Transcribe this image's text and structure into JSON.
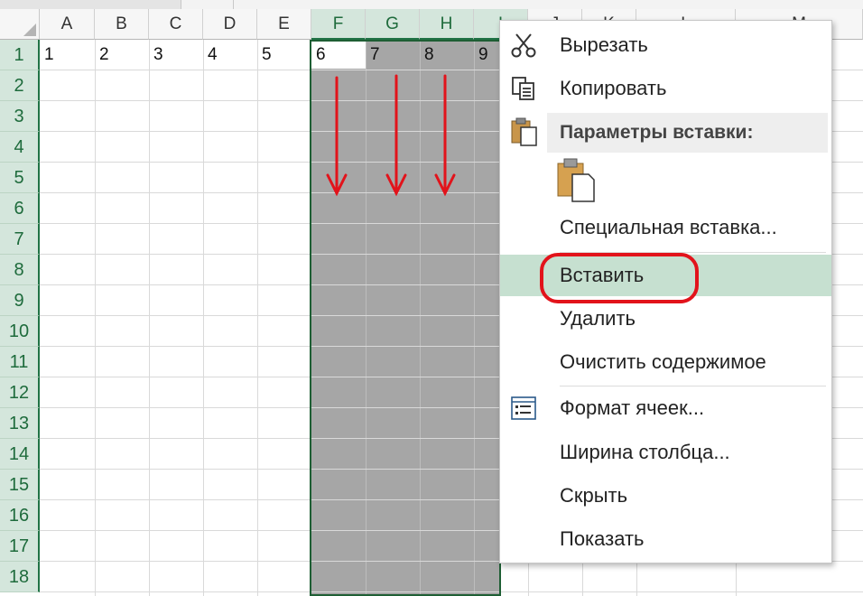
{
  "spreadsheet": {
    "column_headers": [
      "A",
      "B",
      "C",
      "D",
      "E",
      "F",
      "G",
      "H",
      "I",
      "J",
      "K",
      "L",
      "M"
    ],
    "row_headers": [
      "1",
      "2",
      "3",
      "4",
      "5",
      "6",
      "7",
      "8",
      "9",
      "10",
      "11",
      "12",
      "13",
      "14",
      "15",
      "16",
      "17",
      "18"
    ],
    "row1_values": [
      "1",
      "2",
      "3",
      "4",
      "5",
      "6",
      "7",
      "8",
      "9"
    ],
    "selected_columns": [
      "F",
      "G",
      "H",
      "I"
    ],
    "colors": {
      "selection_fill": "#a6a6a6",
      "header_selected": "#d4e6dc",
      "accent": "#217346",
      "arrow": "#e2131b"
    }
  },
  "context_menu": {
    "cut": "Вырезать",
    "copy": "Копировать",
    "paste_options": "Параметры вставки:",
    "paste_special": "Специальная вставка...",
    "insert": "Вставить",
    "delete": "Удалить",
    "clear_contents": "Очистить содержимое",
    "format_cells": "Формат ячеек...",
    "column_width": "Ширина столбца...",
    "hide": "Скрыть",
    "unhide": "Показать",
    "icons": [
      "scissors-icon",
      "copy-icon",
      "paste-clipboard-icon",
      "paste-option-icon",
      "format-cells-icon"
    ],
    "hovered_item": "Вставить"
  }
}
